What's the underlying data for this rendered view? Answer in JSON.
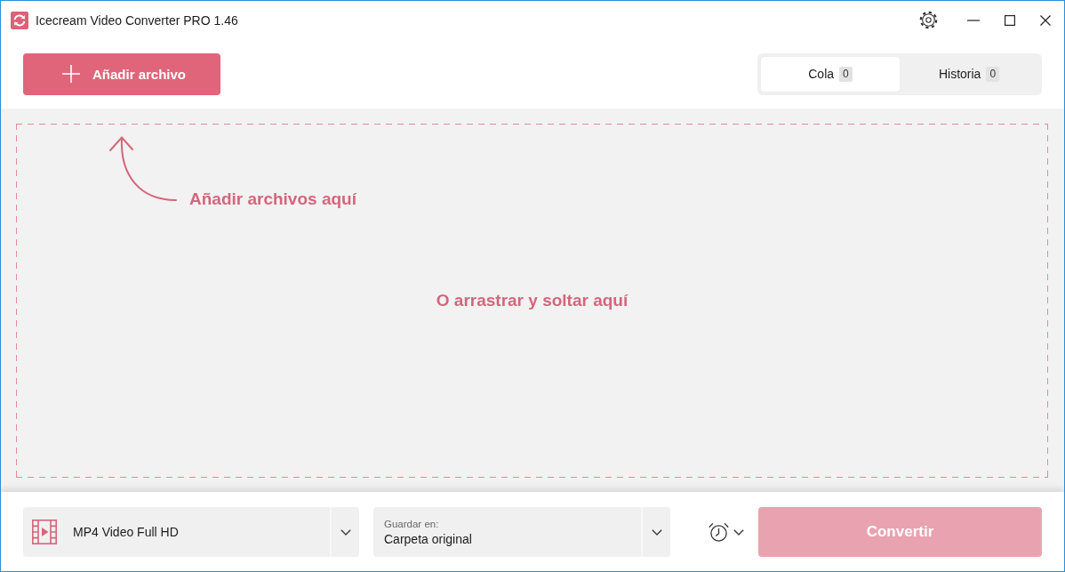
{
  "window": {
    "title": "Icecream Video Converter PRO 1.46"
  },
  "toolbar": {
    "add_button": {
      "label": "Añadir archivo"
    }
  },
  "tabs": [
    {
      "label": "Cola",
      "count": "0",
      "selected": true
    },
    {
      "label": "Historia",
      "count": "0",
      "selected": false
    }
  ],
  "drop_area": {
    "hint": "Añadir archivos aquí",
    "message": "O arrastrar y soltar aquí"
  },
  "bottom_bar": {
    "format": {
      "value": "MP4 Video Full HD"
    },
    "save_location": {
      "label": "Guardar en:",
      "value": "Carpeta original"
    },
    "convert_button": {
      "label": "Convertir",
      "disabled": true
    }
  }
}
